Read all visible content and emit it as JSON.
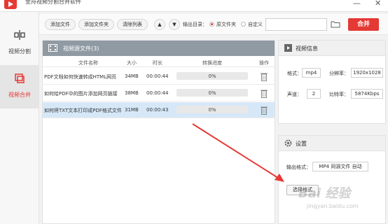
{
  "window": {
    "title": "金舟视频分割合并软件",
    "minimize": "—",
    "close": "✕"
  },
  "sidebar": {
    "items": [
      {
        "label": "视频分割",
        "icon": "split-icon",
        "active": false
      },
      {
        "label": "视频合并",
        "icon": "merge-icon",
        "active": true
      }
    ]
  },
  "toolbar": {
    "add_file": "添加文件",
    "add_folder": "添加文件夹",
    "clear_list": "清除列表",
    "up_icon": "▲",
    "down_icon": "▼",
    "output_dir_label": "输出目录：",
    "source_folder_option": "原文件夹",
    "custom_option": "自定义",
    "path_value": "",
    "merge_button": "合并",
    "accent_color": "#e53935"
  },
  "file_panel": {
    "title": "视频源文件(3)",
    "columns": [
      "文件名称",
      "大小",
      "时长",
      "转换进度",
      "操作"
    ],
    "rows": [
      {
        "name": "PDF文档如何快速转成HTML网页",
        "size": "34MB",
        "duration": "00:00:44",
        "progress_text": "0%",
        "progress": 0,
        "selected": false
      },
      {
        "name": "如何给PDF中的图片添加网页链接",
        "size": "38MB",
        "duration": "00:00:44",
        "progress_text": "0%",
        "progress": 0,
        "selected": false
      },
      {
        "name": "如何将TXT文本打印成PDF格式文件",
        "size": "31MB",
        "duration": "00:00:43",
        "progress_text": "0%",
        "progress": 0,
        "selected": true
      }
    ]
  },
  "info_panel": {
    "title": "视频信息",
    "format_label": "格式：",
    "format_value": "mp4",
    "resolution_label": "分辨率：",
    "resolution_value": "1920x1028",
    "channel_label": "声道：",
    "channel_value": "2",
    "bitrate_label": "比特率：",
    "bitrate_value": "5874Kbps"
  },
  "settings_panel": {
    "title": "设置",
    "output_format_label": "输出格式：",
    "output_format_value": "MP4 同源文件 自动",
    "choose_format_button": "选择格式"
  },
  "watermark": {
    "text": "Bai 经验",
    "sub": "jingyan.baidu.com"
  }
}
